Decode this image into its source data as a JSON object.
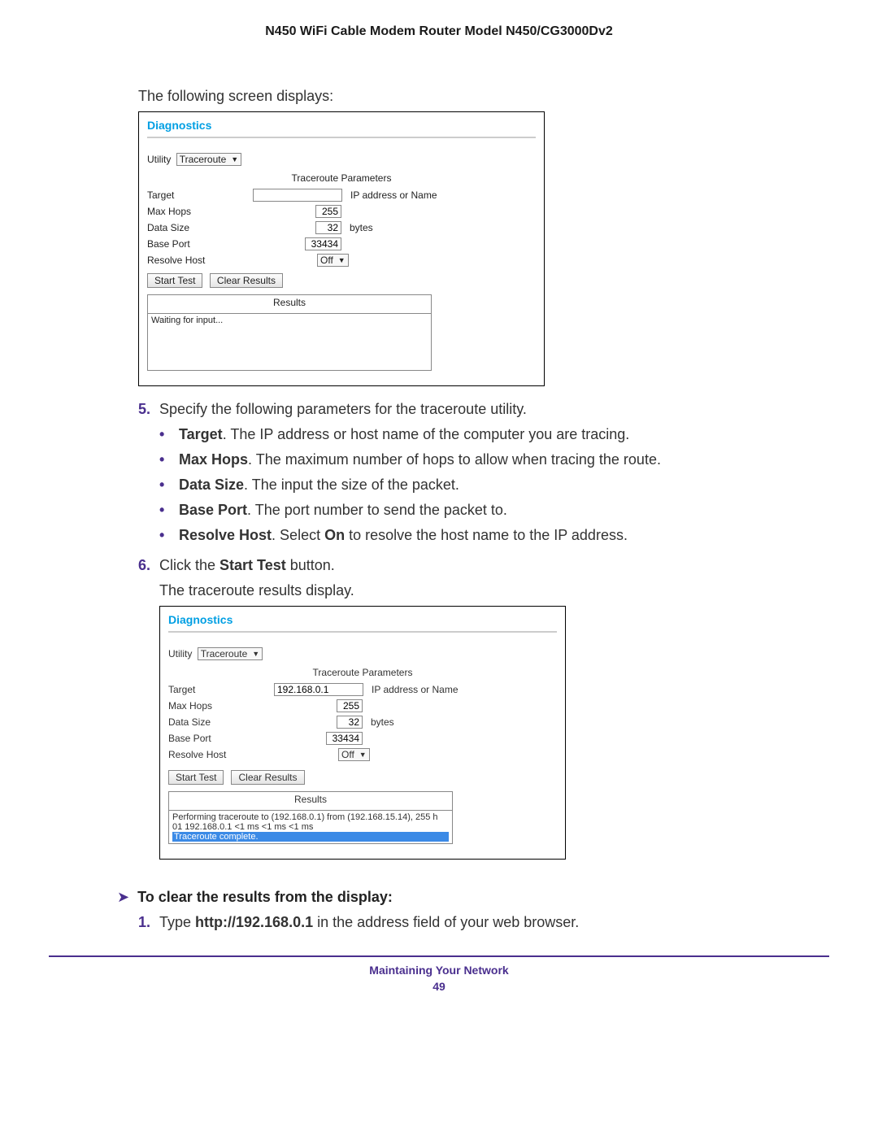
{
  "header": {
    "title": "N450 WiFi Cable Modem Router Model N450/CG3000Dv2"
  },
  "intro1": "The following screen displays:",
  "shot1": {
    "diagnostics": "Diagnostics",
    "utility_label": "Utility",
    "utility_value": "Traceroute",
    "params_title": "Traceroute Parameters",
    "target_label": "Target",
    "target_value": "",
    "target_hint": "IP address or Name",
    "maxhops_label": "Max Hops",
    "maxhops_value": "255",
    "datasize_label": "Data Size",
    "datasize_value": "32",
    "datasize_hint": "bytes",
    "baseport_label": "Base Port",
    "baseport_value": "33434",
    "resolve_label": "Resolve Host",
    "resolve_value": "Off",
    "start_btn": "Start Test",
    "clear_btn": "Clear Results",
    "results_title": "Results",
    "results_text": "Waiting for input..."
  },
  "step5": {
    "num": "5.",
    "text": "Specify the following parameters for the traceroute utility.",
    "bullets": [
      {
        "bold": "Target",
        "text": ". The IP address or host name of the computer you are tracing."
      },
      {
        "bold": "Max Hops",
        "text": ". The maximum number of hops to allow when tracing the route."
      },
      {
        "bold": "Data Size",
        "text": ". The input the size of the packet."
      },
      {
        "bold": "Base Port",
        "text": ". The port number to send the packet to."
      },
      {
        "bold": "Resolve Host",
        "text_pre": ". Select ",
        "bold2": "On",
        "text_post": " to resolve the host name to the IP address."
      }
    ]
  },
  "step6": {
    "num": "6.",
    "text_pre": "Click the ",
    "text_bold": "Start Test",
    "text_post": " button.",
    "sub": "The traceroute results display."
  },
  "shot2": {
    "diagnostics": "Diagnostics",
    "utility_label": "Utility",
    "utility_value": "Traceroute",
    "params_title": "Traceroute Parameters",
    "target_label": "Target",
    "target_value": "192.168.0.1",
    "target_hint": "IP address or Name",
    "maxhops_label": "Max Hops",
    "maxhops_value": "255",
    "datasize_label": "Data Size",
    "datasize_value": "32",
    "datasize_hint": "bytes",
    "baseport_label": "Base Port",
    "baseport_value": "33434",
    "resolve_label": "Resolve Host",
    "resolve_value": "Off",
    "start_btn": "Start Test",
    "clear_btn": "Clear Results",
    "results_title": "Results",
    "results_line1": "Performing traceroute to (192.168.0.1) from (192.168.15.14), 255 h",
    "results_line2": "01 192.168.0.1 <1 ms <1 ms <1 ms",
    "results_line3": "Traceroute complete."
  },
  "clear_section": {
    "heading": "To clear the results from the display:",
    "step1_num": "1.",
    "step1_pre": "Type ",
    "step1_bold": "http://192.168.0.1",
    "step1_post": " in the address field of your web browser."
  },
  "footer": {
    "title": "Maintaining Your Network",
    "page": "49"
  }
}
